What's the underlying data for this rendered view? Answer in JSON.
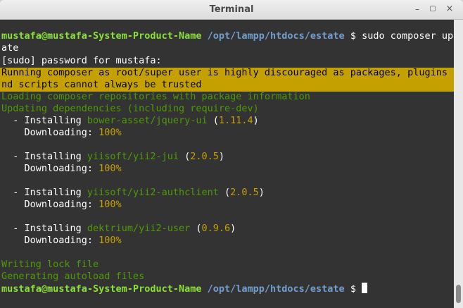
{
  "window": {
    "title": "Terminal",
    "min_symbol": "–",
    "max_symbol": "▢",
    "close_symbol": "×"
  },
  "colors": {
    "prompt_user": "#8ae234",
    "prompt_path": "#729fcf",
    "green": "#4e9a06",
    "yellow": "#c4a000",
    "background": "#333333"
  },
  "lines": {
    "cmd_user": "mustafa@mustafa-System-Product-Name",
    "cmd_path": "/opt/lampp/htdocs/estate",
    "cmd_text": " $ sudo composer upd",
    "cmd_wrap": "ate",
    "sudo": "[sudo] password for mustafa:",
    "warn1": "Running composer as root/super user is highly discouraged as packages, plugins a",
    "warn2": "nd scripts cannot always be trusted",
    "loading": "Loading composer repositories with package information",
    "updating": "Updating dependencies (including require-dev)",
    "writing": "Writing lock file",
    "generating": "Generating autoload files",
    "final_user": "mustafa@mustafa-System-Product-Name",
    "final_path": "/opt/lampp/htdocs/estate",
    "final_text": " $ "
  },
  "installs": [
    {
      "prefix": "  - Installing ",
      "package": "bower-asset/jquery-ui",
      "version": "1.11.4",
      "downloading": "    Downloading: ",
      "percent": "100%"
    },
    {
      "prefix": "  - Installing ",
      "package": "yiisoft/yii2-jui",
      "version": "2.0.5",
      "downloading": "    Downloading: ",
      "percent": "100%"
    },
    {
      "prefix": "  - Installing ",
      "package": "yiisoft/yii2-authclient",
      "version": "2.0.5",
      "downloading": "    Downloading: ",
      "percent": "100%"
    },
    {
      "prefix": "  - Installing ",
      "package": "dektrium/yii2-user",
      "version": "0.9.6",
      "downloading": "    Downloading: ",
      "percent": "100%"
    }
  ]
}
